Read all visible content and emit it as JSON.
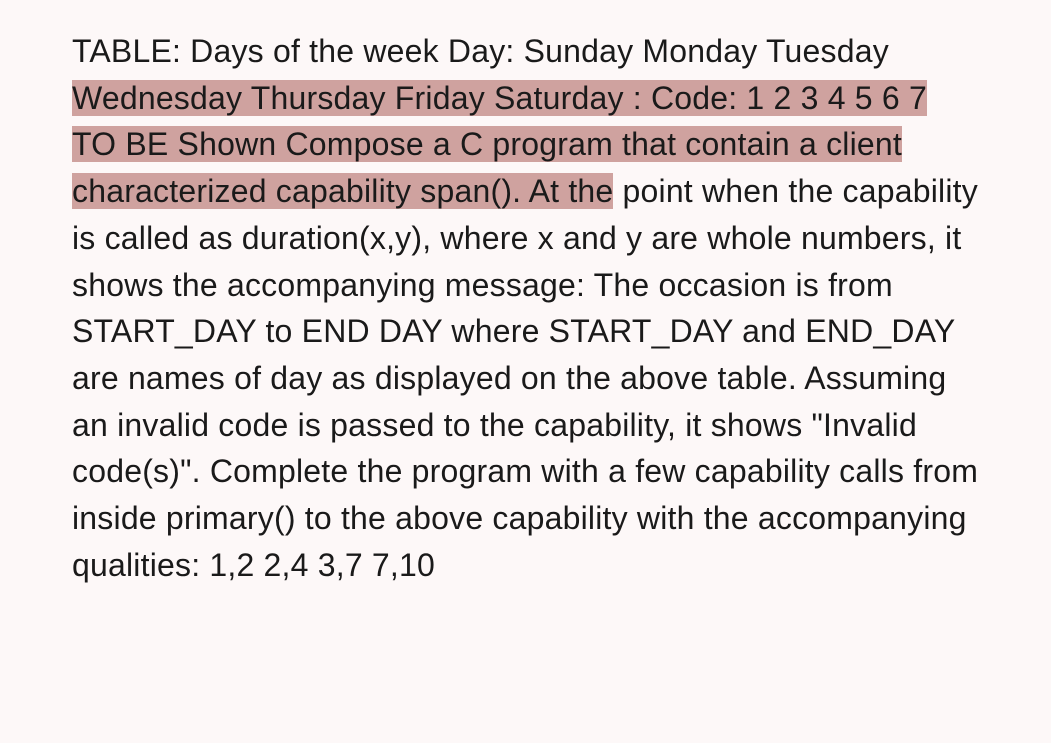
{
  "paragraph": {
    "part1": "TABLE: Days of the week Day: Sunday Monday Tuesday ",
    "highlighted": "Wednesday Thursday Friday Saturday : Code: 1 2 3 4 5 6 7 TO BE Shown Compose a C program that contain a client characterized capability span(). At the",
    "part2": " point when the capability is called as duration(x,y), where x and y are whole numbers, it shows the accompanying message: The occasion is from START_DAY to END DAY where START_DAY and END_DAY are names of day as displayed on the above table. Assuming an invalid code is passed to the capability, it shows \"Invalid code(s)\". Complete the program with a few capability calls from inside primary() to the above capability with the accompanying qualities: 1,2 2,4 3,7 7,10"
  }
}
